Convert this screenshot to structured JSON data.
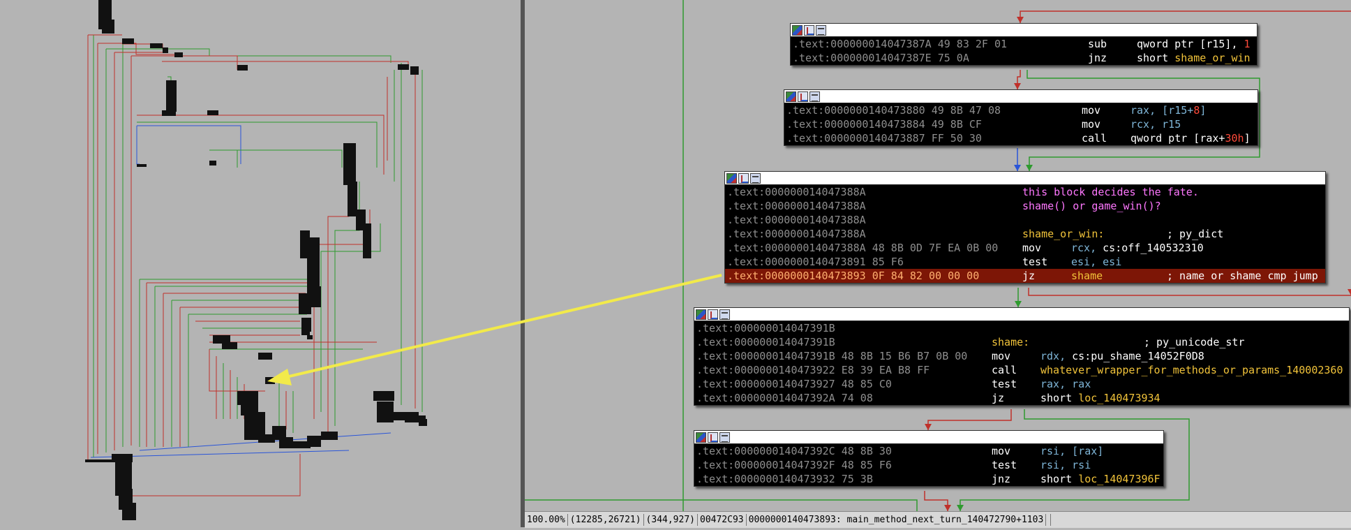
{
  "blocks": {
    "b1": [
      {
        "addr": ".text:000000014047387A 49 83 2F 01",
        "mn": "sub",
        "ops": [
          [
            "w",
            "qword ptr [r15], "
          ],
          [
            "num",
            "1"
          ]
        ]
      },
      {
        "addr": ".text:000000014047387E 75 0A",
        "mn": "jnz",
        "ops": [
          [
            "w",
            "short "
          ],
          [
            "sym",
            "shame_or_win"
          ]
        ]
      }
    ],
    "b2": [
      {
        "addr": ".text:0000000140473880 49 8B 47 08",
        "mn": "mov",
        "ops": [
          [
            "op",
            "rax, [r15+"
          ],
          [
            "num",
            "8"
          ],
          [
            "op",
            "]"
          ]
        ]
      },
      {
        "addr": ".text:0000000140473884 49 8B CF",
        "mn": "mov",
        "ops": [
          [
            "op",
            "rcx, r15"
          ]
        ]
      },
      {
        "addr": ".text:0000000140473887 FF 50 30",
        "mn": "call",
        "ops": [
          [
            "w",
            "qword ptr [rax+"
          ],
          [
            "num",
            "30h"
          ],
          [
            "w",
            "]"
          ]
        ]
      }
    ],
    "b3": [
      {
        "addr": ".text:000000014047388A",
        "cmt": "this block decides the fate."
      },
      {
        "addr": ".text:000000014047388A",
        "cmt": "shame() or game_win()?"
      },
      {
        "addr": ".text:000000014047388A"
      },
      {
        "addr": ".text:000000014047388A",
        "label": "shame_or_win:",
        "rcmt": "; py_dict"
      },
      {
        "addr": ".text:000000014047388A 48 8B 0D 7F EA 0B 00",
        "mn": "mov",
        "ops": [
          [
            "op",
            "rcx, "
          ],
          [
            "w",
            "cs:off_140532310"
          ]
        ]
      },
      {
        "addr": ".text:0000000140473891 85 F6",
        "mn": "test",
        "ops": [
          [
            "op",
            "esi, esi"
          ]
        ]
      },
      {
        "addr": ".text:0000000140473893 0F 84 82 00 00 00",
        "mn": "jz",
        "ops": [
          [
            "sym",
            "shame"
          ]
        ],
        "rcmt": "; name or shame cmp jump",
        "hl": true
      }
    ],
    "b4": [
      {
        "addr": ".text:000000014047391B"
      },
      {
        "addr": ".text:000000014047391B",
        "label": "shame:",
        "rcmt": "; py_unicode_str"
      },
      {
        "addr": ".text:000000014047391B 48 8B 15 B6 B7 0B 00",
        "mn": "mov",
        "ops": [
          [
            "op",
            "rdx, "
          ],
          [
            "w",
            "cs:pu_shame_14052F0D8"
          ]
        ]
      },
      {
        "addr": ".text:0000000140473922 E8 39 EA B8 FF",
        "mn": "call",
        "ops": [
          [
            "sym",
            "whatever_wrapper_for_methods_or_params_140002360"
          ]
        ]
      },
      {
        "addr": ".text:0000000140473927 48 85 C0",
        "mn": "test",
        "ops": [
          [
            "op",
            "rax, rax"
          ]
        ]
      },
      {
        "addr": ".text:000000014047392A 74 08",
        "mn": "jz",
        "ops": [
          [
            "w",
            "short "
          ],
          [
            "sym",
            "loc_140473934"
          ]
        ]
      }
    ],
    "b5": [
      {
        "addr": ".text:000000014047392C 48 8B 30",
        "mn": "mov",
        "ops": [
          [
            "op",
            "rsi, [rax]"
          ]
        ]
      },
      {
        "addr": ".text:000000014047392F 48 85 F6",
        "mn": "test",
        "ops": [
          [
            "op",
            "rsi, rsi"
          ]
        ]
      },
      {
        "addr": ".text:0000000140473932 75 3B",
        "mn": "jnz",
        "ops": [
          [
            "w",
            "short "
          ],
          [
            "sym",
            "loc_14047396F"
          ]
        ]
      }
    ]
  },
  "status": {
    "zoom": "100.00%",
    "coords": "(12285,26721)",
    "mouse": "(344,927)",
    "offset": "00472C93",
    "location": "0000000140473893: main_method_next_turn_140472790+1103"
  },
  "colors": {
    "background": "#b4b4b4",
    "edge_true": "#2e9a2e",
    "edge_false": "#c0302a",
    "edge_uncond": "#2a55d8",
    "highlight_line": "#7d1606",
    "annotation_arrow": "#f2ea4a"
  }
}
